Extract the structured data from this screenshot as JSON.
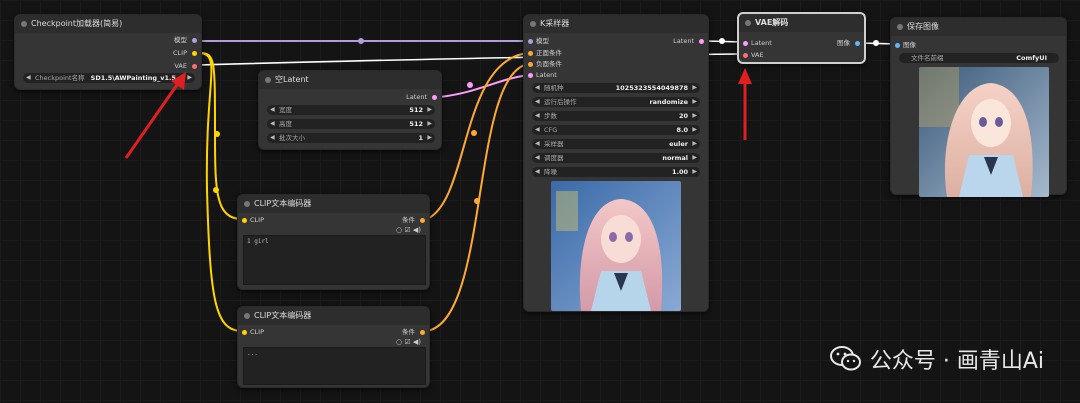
{
  "colors": {
    "model": "#b39ddb",
    "clip": "#ffd500",
    "vae": "#ff6e6e",
    "latent": "#ff9cf9",
    "conditioning": "#ffa931",
    "image": "#64b5f6",
    "arrow": "#e02020"
  },
  "checkpoint": {
    "title": "Checkpoint加载器(简易)",
    "outputs": [
      "模型",
      "CLIP",
      "VAE"
    ],
    "widget_label": "Checkpoint名称",
    "widget_value": "SD1.5\\AWPainting_v1.5..."
  },
  "empty_latent": {
    "title": "空Latent",
    "output": "Latent",
    "widgets": [
      {
        "label": "宽度",
        "value": "512"
      },
      {
        "label": "高度",
        "value": "512"
      },
      {
        "label": "批次大小",
        "value": "1"
      }
    ]
  },
  "clip_pos": {
    "title": "CLIP文本编码器",
    "input": "CLIP",
    "output": "条件",
    "text": "1 girl"
  },
  "clip_neg": {
    "title": "CLIP文本编码器",
    "input": "CLIP",
    "output": "条件",
    "text": "..."
  },
  "ksampler": {
    "title": "K采样器",
    "inputs": [
      "模型",
      "正面条件",
      "负面条件",
      "Latent"
    ],
    "output": "Latent",
    "widgets": [
      {
        "label": "随机种",
        "value": "1025323554049878"
      },
      {
        "label": "运行后操作",
        "value": "randomize"
      },
      {
        "label": "步数",
        "value": "20"
      },
      {
        "label": "CFG",
        "value": "8.0"
      },
      {
        "label": "采样器",
        "value": "euler"
      },
      {
        "label": "调度器",
        "value": "normal"
      },
      {
        "label": "降噪",
        "value": "1.00"
      }
    ]
  },
  "vae_decode": {
    "title": "VAE解码",
    "inputs": [
      "Latent",
      "VAE"
    ],
    "output": "图像"
  },
  "save_image": {
    "title": "保存图像",
    "input": "图像",
    "widget_label": "文件名前缀",
    "widget_value": "ComfyUI"
  },
  "watermark": {
    "text": "公众号 · 画青山Ai"
  }
}
